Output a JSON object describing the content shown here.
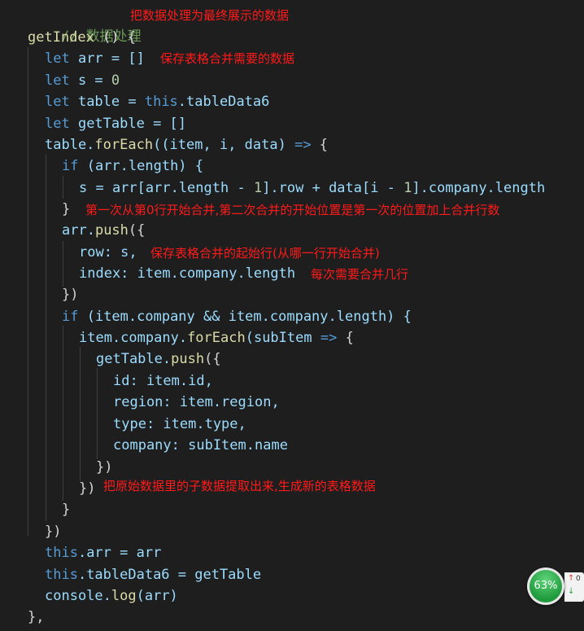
{
  "code": {
    "comment_main": "// 数据处理",
    "fn_name": "getIndex",
    "fn_sig_rest": " () {",
    "let_kw": "let",
    "arr_decl": " arr = []",
    "s_decl_name": " s = ",
    "s_decl_val": "0",
    "table_decl": " table = ",
    "this_kw": "this",
    "table_decl_rest": ".tableData6",
    "gettable_decl": " getTable = []",
    "foreach_obj": "table.",
    "foreach_fn": "forEach",
    "foreach_args": "((item, i, data) ",
    "arrow": "=>",
    "brace_open": " {",
    "if_kw": "if",
    "if1_cond": " (arr.length) {",
    "s_assign_a": "s = arr[arr.length - ",
    "one": "1",
    "s_assign_b": "].row + data[i - ",
    "s_assign_c": "].company.length",
    "close_brace": "}",
    "push_obj": "arr.",
    "push_fn": "push",
    "push_open": "({",
    "row_line": "row: s,",
    "index_line": "index: item.company.length",
    "close_paren": "})",
    "if2_cond": " (item.company && item.company.length) {",
    "inner_foreach_obj": "item.company.",
    "inner_foreach_args": "(subItem ",
    "gettable_push_obj": "getTable.",
    "id_line": "id: item.id,",
    "region_line": "region: item.region,",
    "type_line": "type: item.type,",
    "company_line": "company: subItem.name",
    "close_all": "})",
    "this_arr_rest": ".arr = arr",
    "this_tbl_rest": ".tableData6 = getTable",
    "console_obj": "console.",
    "log_fn": "log",
    "log_args": "(arr)",
    "end_line": "},"
  },
  "annotations": {
    "a1": "把数据处理为最终展示的数据",
    "a2": "保存表格合并需要的数据",
    "a3": "第一次从第0行开始合并,第二次合并的开始位置是第一次的位置加上合并行数",
    "a4": "保存表格合并的起始行(从哪一行开始合并)",
    "a5": "每次需要合并几行",
    "a6": "把原始数据里的子数据提取出来,生成新的表格数据"
  },
  "widget": {
    "percent": "63%",
    "up_arrow": "↑",
    "down_arrow": "↓",
    "value": "0"
  },
  "colors": {
    "background": "#1e1e1e",
    "keyword": "#569cd6",
    "function": "#dcdcaa",
    "variable": "#9cdcfe",
    "number": "#b5cea8",
    "comment": "#6a9955",
    "annotation": "#ff1a1a",
    "widget_green": "#1f9a3c"
  }
}
